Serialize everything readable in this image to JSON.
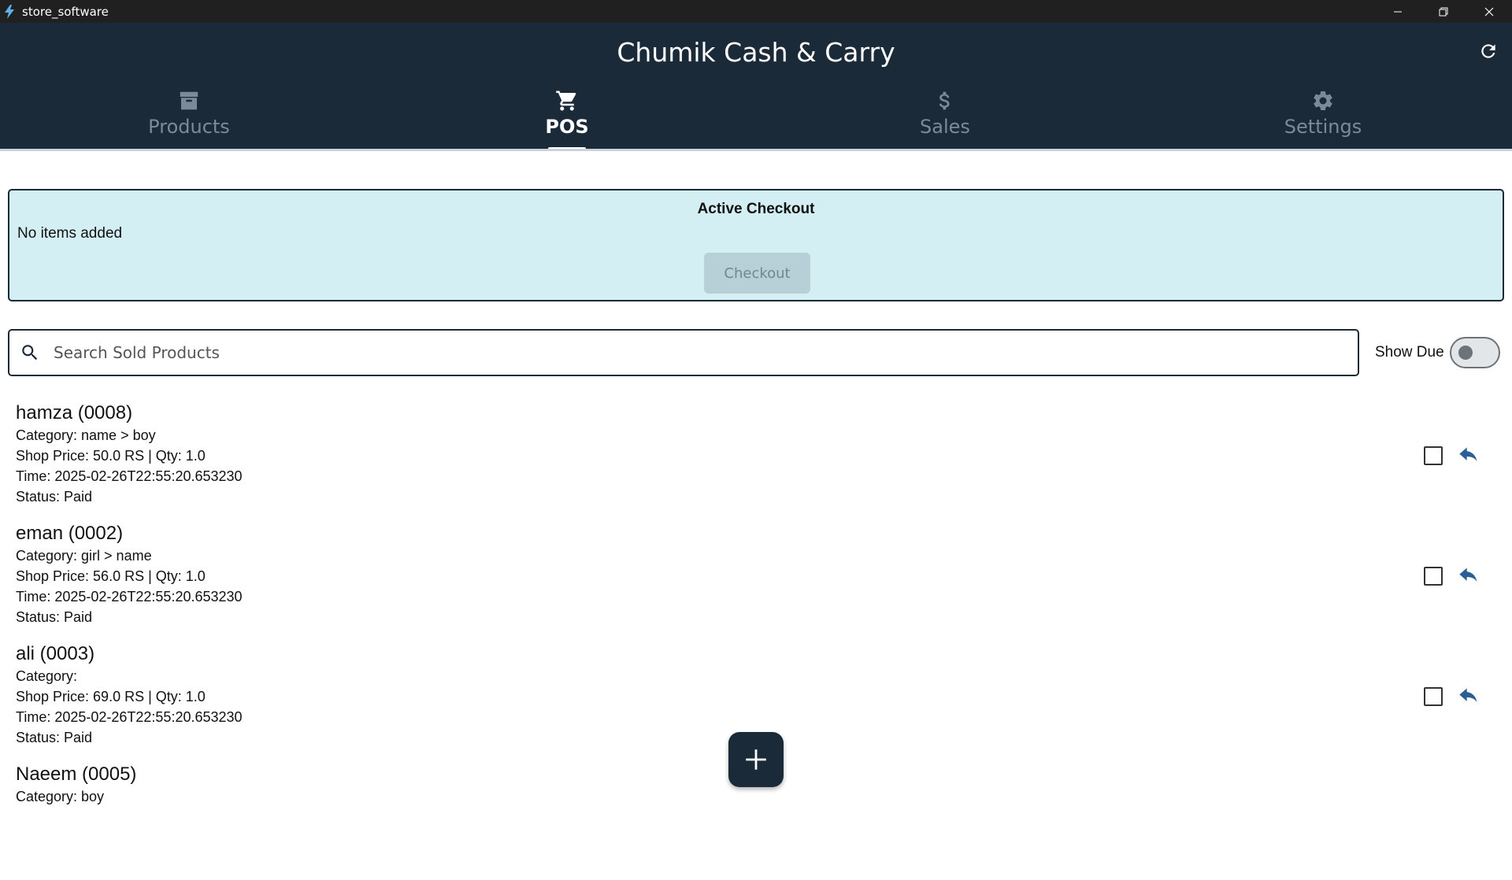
{
  "window": {
    "title": "store_software",
    "icon": "bolt-icon"
  },
  "header": {
    "title": "Chumik Cash & Carry",
    "refresh_icon": "refresh-icon"
  },
  "tabs": [
    {
      "label": "Products",
      "icon": "archive-box-icon",
      "active": false
    },
    {
      "label": "POS",
      "icon": "cart-icon",
      "active": true
    },
    {
      "label": "Sales",
      "icon": "dollar-icon",
      "active": false
    },
    {
      "label": "Settings",
      "icon": "gear-icon",
      "active": false
    }
  ],
  "checkout": {
    "title": "Active Checkout",
    "empty_text": "No items added",
    "button_label": "Checkout"
  },
  "search": {
    "placeholder": "Search Sold Products",
    "value": ""
  },
  "filters": {
    "show_due_label": "Show Due",
    "show_due_on": false
  },
  "sold_items": [
    {
      "name": "hamza (0008)",
      "category": "Category: name > boy",
      "price_qty": "Shop Price: 50.0 RS | Qty: 1.0",
      "time": "Time: 2025-02-26T22:55:20.653230",
      "status": "Status: Paid"
    },
    {
      "name": "eman (0002)",
      "category": "Category: girl > name",
      "price_qty": "Shop Price: 56.0 RS | Qty: 1.0",
      "time": "Time: 2025-02-26T22:55:20.653230",
      "status": "Status: Paid"
    },
    {
      "name": "ali (0003)",
      "category": "Category:",
      "price_qty": "Shop Price: 69.0 RS | Qty: 1.0",
      "time": "Time: 2025-02-26T22:55:20.653230",
      "status": "Status: Paid"
    },
    {
      "name": "Naeem (0005)",
      "category": "Category: boy",
      "price_qty": "",
      "time": "",
      "status": ""
    }
  ],
  "colors": {
    "header_bg": "#1b2a38",
    "checkout_bg": "#d3eff4",
    "accent_blue": "#2a5f93"
  }
}
